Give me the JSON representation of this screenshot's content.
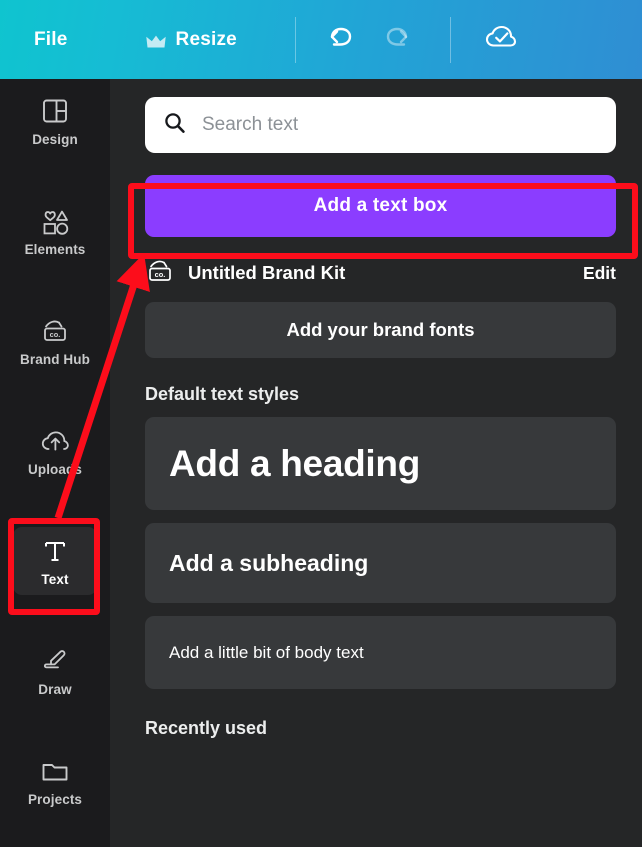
{
  "theme": {
    "topbar_gradient_from": "#0fc4cf",
    "topbar_gradient_to": "#2f8ed3",
    "sidebar_bg": "#1b1b1d",
    "panel_bg": "#252627",
    "card_bg": "#37393b",
    "accent_purple": "#8b3dff",
    "annotation_red": "#fc0d1b"
  },
  "topbar": {
    "file_label": "File",
    "resize_label": "Resize",
    "resize_icon": "crown-icon",
    "undo_icon": "undo-arrow-icon",
    "redo_icon": "redo-arrow-icon",
    "save_status_icon": "cloud-check-icon",
    "undo_enabled": "true",
    "redo_enabled": "false"
  },
  "sidebar": {
    "items": [
      {
        "label": "Design",
        "icon": "layout-panels-icon",
        "active": "false"
      },
      {
        "label": "Elements",
        "icon": "shapes-icon",
        "active": "false"
      },
      {
        "label": "Brand Hub",
        "icon": "brand-card-icon",
        "active": "false"
      },
      {
        "label": "Uploads",
        "icon": "cloud-upload-icon",
        "active": "false"
      },
      {
        "label": "Text",
        "icon": "text-t-icon",
        "active": "true"
      },
      {
        "label": "Draw",
        "icon": "pen-draw-icon",
        "active": "false"
      },
      {
        "label": "Projects",
        "icon": "folder-icon",
        "active": "false"
      }
    ]
  },
  "panel": {
    "search": {
      "placeholder": "Search text",
      "value": "",
      "icon": "search-icon"
    },
    "add_text_box_label": "Add a text box",
    "brand_kit": {
      "icon": "brand-card-icon",
      "name": "Untitled Brand Kit",
      "edit_label": "Edit",
      "add_fonts_label": "Add your brand fonts"
    },
    "default_text_styles": {
      "heading_label": "Default text styles",
      "cards": [
        {
          "label": "Add a heading"
        },
        {
          "label": "Add a subheading"
        },
        {
          "label": "Add a little bit of body text"
        }
      ]
    },
    "recently_used_label": "Recently used"
  },
  "annotations": {
    "highlight_boxes": [
      {
        "target": "add-text-box-button"
      },
      {
        "target": "sidebar-item-text"
      }
    ],
    "arrow": {
      "from": "sidebar-item-text",
      "to": "add-text-box-button",
      "color": "#fc0d1b"
    }
  }
}
